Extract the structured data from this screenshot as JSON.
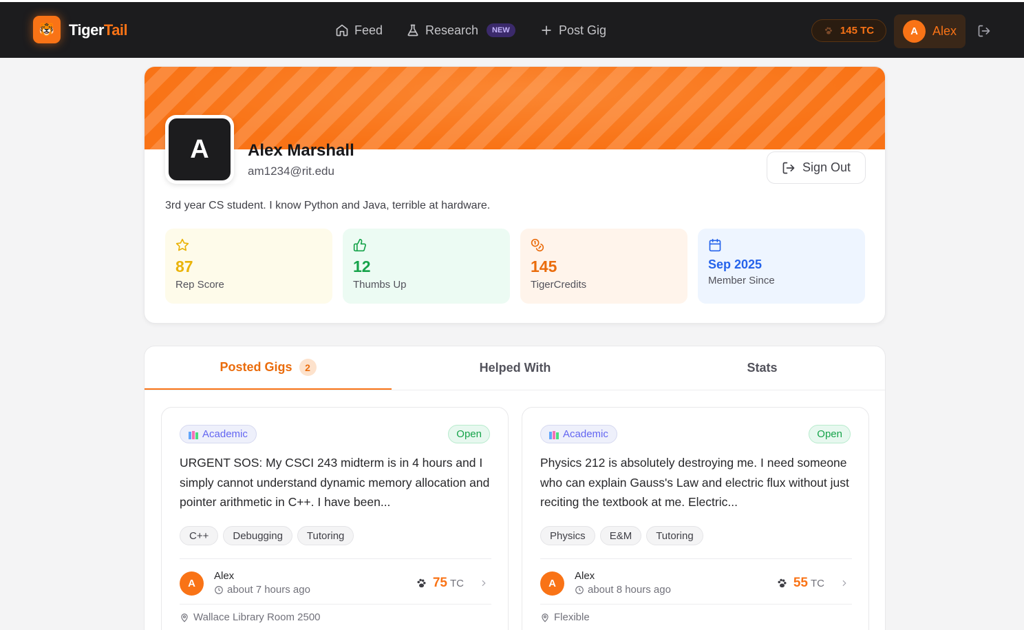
{
  "nav": {
    "brand_part1": "Tiger",
    "brand_part2": "Tail",
    "logo_icon": "tiger-icon",
    "items": [
      {
        "label": "Feed",
        "icon": "home-icon"
      },
      {
        "label": "Research",
        "icon": "flask-icon",
        "badge": "NEW"
      },
      {
        "label": "Post Gig",
        "icon": "plus-icon"
      }
    ],
    "credits": "145 TC",
    "user_initial": "A",
    "user_name": "Alex"
  },
  "profile": {
    "initial": "A",
    "name": "Alex Marshall",
    "email": "am1234@rit.edu",
    "signout_label": "Sign Out",
    "bio": "3rd year CS student. I know Python and Java, terrible at hardware.",
    "stats": [
      {
        "value": "87",
        "label": "Rep Score",
        "icon": "star-icon",
        "color": "#eab308",
        "bg": "#fefbea"
      },
      {
        "value": "12",
        "label": "Thumbs Up",
        "icon": "thumbs-up-icon",
        "color": "#16a34a",
        "bg": "#ecfbf3"
      },
      {
        "value": "145",
        "label": "TigerCredits",
        "icon": "coins-icon",
        "color": "#ea6c0c",
        "bg": "#fff4eb"
      },
      {
        "value": "Sep 2025",
        "label": "Member Since",
        "icon": "calendar-icon",
        "color": "#2563eb",
        "bg": "#eef5ff"
      }
    ]
  },
  "tabs": [
    {
      "label": "Posted Gigs",
      "count": "2"
    },
    {
      "label": "Helped With"
    },
    {
      "label": "Stats"
    }
  ],
  "gigs": [
    {
      "category": "Academic",
      "status": "Open",
      "description": "URGENT SOS: My CSCI 243 midterm is in 4 hours and I simply cannot understand dynamic memory allocation and pointer arithmetic in C++. I have been...",
      "tags": [
        "C++",
        "Debugging",
        "Tutoring"
      ],
      "poster_initial": "A",
      "poster": "Alex",
      "time": "about 7 hours ago",
      "reward": "75",
      "unit": "TC",
      "location": "Wallace Library Room 2500"
    },
    {
      "category": "Academic",
      "status": "Open",
      "description": "Physics 212 is absolutely destroying me. I need someone who can explain Gauss's Law and electric flux without just reciting the textbook at me. Electric...",
      "tags": [
        "Physics",
        "E&M",
        "Tutoring"
      ],
      "poster_initial": "A",
      "poster": "Alex",
      "time": "about 8 hours ago",
      "reward": "55",
      "unit": "TC",
      "location": "Flexible"
    }
  ]
}
